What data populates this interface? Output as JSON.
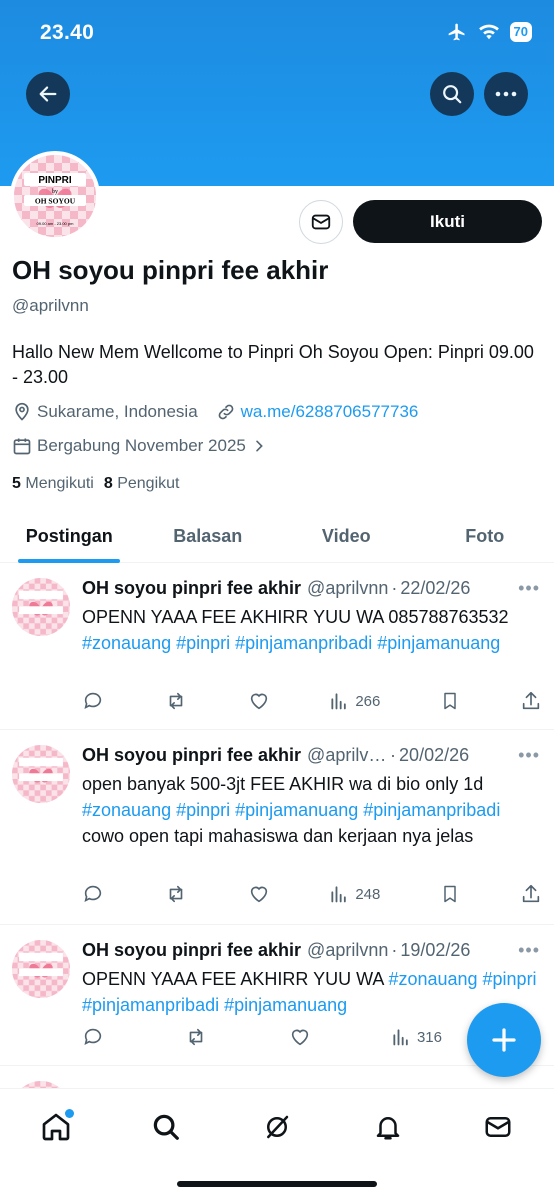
{
  "status_bar": {
    "time": "23.40",
    "battery": "70"
  },
  "profile": {
    "name": "OH soyou pinpri fee akhir",
    "handle": "@aprilvnn",
    "follow_label": "Ikuti",
    "bio": "Hallo New Mem Wellcome to Pinpri Oh Soyou Open: Pinpri 09.00 - 23.00",
    "location": "Sukarame, Indonesia",
    "link": "wa.me/6288706577736",
    "joined": "Bergabung November 2025",
    "following_count": "5",
    "following_label": "Mengikuti",
    "followers_count": "8",
    "followers_label": "Pengikut",
    "avatar_text": {
      "top": "PINPRI",
      "by": "by",
      "brand": "OH SOYOU",
      "hours": "09.00 am - 23.00 pm"
    }
  },
  "tabs": [
    {
      "label": "Postingan",
      "active": true
    },
    {
      "label": "Balasan",
      "active": false
    },
    {
      "label": "Video",
      "active": false
    },
    {
      "label": "Foto",
      "active": false
    }
  ],
  "tweets": [
    {
      "name": "OH soyou pinpri fee akhir",
      "handle": "@aprilvnn",
      "date": "22/02/26",
      "text_plain": "OPENN YAAA FEE AKHIRR YUU WA 085788763532",
      "hashtags": "#zonauang #pinpri #pinjamanpribadi #pinjamanuang",
      "views": "266"
    },
    {
      "name": "OH soyou pinpri fee akhir",
      "handle": "@aprilvnn",
      "date": "20/02/26",
      "text_plain": "open banyak 500-3jt FEE AKHIR wa di bio only 1d",
      "hashtags": "#zonauang #pinpri #pinjamanuang #pinjamanpribadi",
      "text_tail": "cowo open tapi mahasiswa dan kerjaan nya jelas",
      "views": "248"
    },
    {
      "name": "OH soyou pinpri fee akhir",
      "handle": "@aprilvnn",
      "date": "19/02/26",
      "text_plain": "OPENN YAAA FEE AKHIRR YUU WA",
      "hashtags": "#zonauang #pinpri #pinjamanpribadi #pinjamanuang",
      "views": "316"
    }
  ],
  "colors": {
    "accent": "#1d9bf0",
    "text": "#0f1419",
    "muted": "#536471"
  }
}
